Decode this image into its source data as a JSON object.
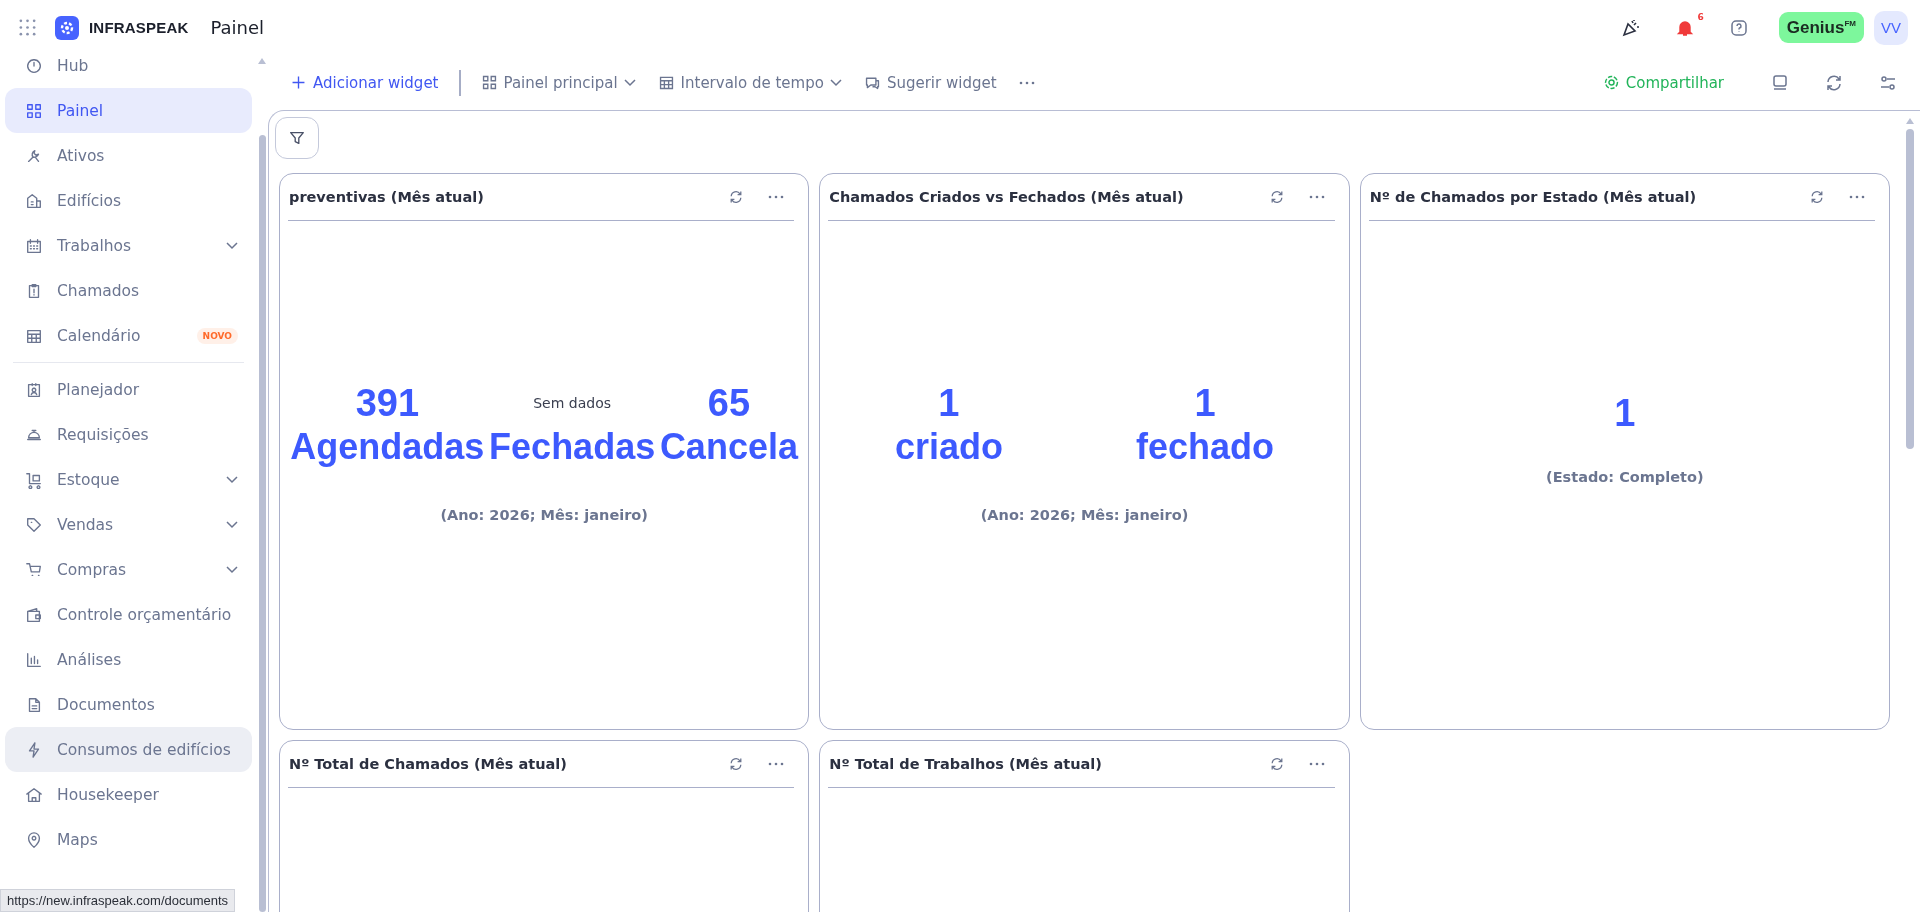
{
  "header": {
    "logo_text": "INFRASPEAK",
    "page_title": "Painel",
    "notification_count": "6",
    "plan_badge": "Genius$^{FM}$",
    "avatar": "VV"
  },
  "sidebar": {
    "groups": [
      [
        {
          "label": "Hub",
          "selected": false,
          "expandable": false,
          "hovered": false
        },
        {
          "label": "Painel",
          "selected": true,
          "expandable": false,
          "hovered": false
        },
        {
          "label": "Ativos",
          "selected": false,
          "expandable": false,
          "hovered": false
        },
        {
          "label": "Edifícios",
          "selected": false,
          "expandable": false,
          "hovered": false
        },
        {
          "label": "Trabalhos",
          "selected": false,
          "expandable": true,
          "hovered": false
        },
        {
          "label": "Chamados",
          "selected": false,
          "expandable": false,
          "hovered": false
        },
        {
          "label": "Calendário",
          "selected": false,
          "expandable": false,
          "hovered": false,
          "badge": "NOVO"
        }
      ],
      [
        {
          "label": "Planejador",
          "selected": false,
          "expandable": false,
          "hovered": false
        },
        {
          "label": "Requisições",
          "selected": false,
          "expandable": false,
          "hovered": false
        },
        {
          "label": "Estoque",
          "selected": false,
          "expandable": true,
          "hovered": false
        },
        {
          "label": "Vendas",
          "selected": false,
          "expandable": true,
          "hovered": false
        },
        {
          "label": "Compras",
          "selected": false,
          "expandable": true,
          "hovered": false
        },
        {
          "label": "Controle orçamentário",
          "selected": false,
          "expandable": false,
          "hovered": false
        },
        {
          "label": "Análises",
          "selected": false,
          "expandable": false,
          "hovered": false
        },
        {
          "label": "Documentos",
          "selected": false,
          "expandable": false,
          "hovered": false
        },
        {
          "label": "Consumos de edifícios",
          "selected": false,
          "expandable": false,
          "hovered": true
        },
        {
          "label": "Housekeeper",
          "selected": false,
          "expandable": false,
          "hovered": false
        },
        {
          "label": "Maps",
          "selected": false,
          "expandable": false,
          "hovered": false
        }
      ]
    ]
  },
  "toolbar": {
    "left": [
      {
        "kind": "add",
        "label": "Adicionar widget"
      },
      {
        "kind": "dropdown",
        "label": "Painel principal"
      },
      {
        "kind": "dropdown",
        "label": "Intervalo de tempo"
      },
      {
        "kind": "suggest",
        "label": "Sugerir widget"
      },
      {
        "kind": "more"
      }
    ],
    "share": "Compartilhar"
  },
  "widgets": [
    {
      "title": "preventivas (Mês atual)",
      "kind": "stats",
      "stats": [
        {
          "value": "391",
          "label": "Agendadas"
        },
        {
          "note": "Sem dados",
          "label": "Fechadas"
        },
        {
          "value": "65",
          "label": "Cancela"
        }
      ],
      "caption": "(Ano: 2026; Mês: janeiro)"
    },
    {
      "title": "Chamados Criados vs Fechados (Mês atual)",
      "kind": "stats",
      "stats": [
        {
          "value": "1",
          "label": "criado"
        },
        {
          "value": "1",
          "label": "fechado"
        }
      ],
      "caption": "(Ano: 2026; Mês: janeiro)"
    },
    {
      "title": "Nº de Chamados por Estado (Mês atual)",
      "kind": "single",
      "value": "1",
      "caption": "(Estado: Completo)"
    },
    {
      "title": "Nº Total de Chamados (Mês atual)",
      "kind": "empty"
    },
    {
      "title": "Nº Total de Trabalhos (Mês atual)",
      "kind": "empty"
    }
  ],
  "status_url": "https://new.infraspeak.com/documents"
}
